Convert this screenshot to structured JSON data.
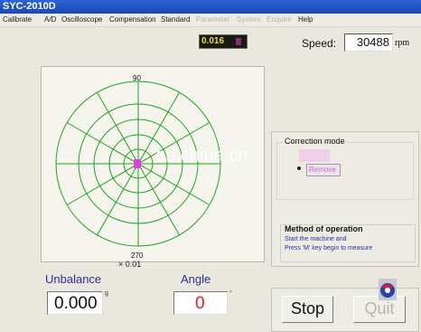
{
  "window": {
    "title": "SYC-2010D"
  },
  "menu": {
    "items": [
      {
        "label": "Calibrate",
        "enabled": true
      },
      {
        "label": "A/D",
        "enabled": true
      },
      {
        "label": "Oscilloscope",
        "enabled": true
      },
      {
        "label": "Compensation",
        "enabled": true
      },
      {
        "label": "Standard",
        "enabled": true
      },
      {
        "label": "Parameter",
        "enabled": false
      },
      {
        "label": "System",
        "enabled": false
      },
      {
        "label": "Enquire",
        "enabled": false
      },
      {
        "label": "Help",
        "enabled": true
      }
    ]
  },
  "readout": {
    "value": "0.016"
  },
  "speed": {
    "label": "Speed:",
    "value": "30488",
    "unit": "rpm"
  },
  "polar_plot": {
    "top_label": "90",
    "bottom_label": "270",
    "scale_label": "× 0.01",
    "grid_color": "#1fa31f",
    "point_color": "#e040e0"
  },
  "unbalance": {
    "label": "Unbalance",
    "value": "0.000",
    "unit": "g"
  },
  "angle": {
    "label": "Angle",
    "value": "0",
    "unit": "°"
  },
  "correction_mode": {
    "title": "Correction mode",
    "option": "Remove"
  },
  "method": {
    "title": "Method of operation",
    "line1": "Start the machine and",
    "line2": "Press 'M' key begin to measure"
  },
  "watermark": {
    "text": "en.china.cn"
  },
  "buttons": {
    "stop": "Stop",
    "quit": "Quit"
  },
  "colors": {
    "accent_blue": "#2a2fa0",
    "angle_red": "#d9181f",
    "title_bar": "#1b47b5"
  }
}
